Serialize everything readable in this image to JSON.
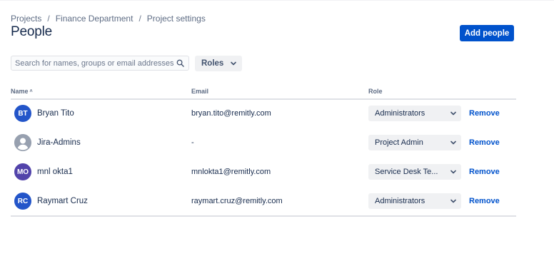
{
  "breadcrumb": [
    "Projects",
    "Finance Department",
    "Project settings"
  ],
  "breadcrumb_separator": "/",
  "page_title": "People",
  "add_button_label": "Add people",
  "search": {
    "placeholder": "Search for names, groups or email addresses",
    "value": "",
    "icon": "search-icon"
  },
  "roles_filter_label": "Roles",
  "table": {
    "headers": {
      "name": "Name",
      "name_sort": "˄",
      "email": "Email",
      "role": "Role"
    },
    "rows": [
      {
        "name": "Bryan Tito",
        "initials": "BT",
        "avatar_color": "#2355c9",
        "email": "bryan.tito@remitly.com",
        "role": "Administrators",
        "action": "Remove"
      },
      {
        "name": "Jira-Admins",
        "initials": "",
        "avatar_color": "#97a0af",
        "email": "-",
        "role": "Project Admin",
        "action": "Remove"
      },
      {
        "name": "mnl okta1",
        "initials": "MO",
        "avatar_color": "#5243aa",
        "email": "mnlokta1@remitly.com",
        "role": "Service Desk Te...",
        "action": "Remove"
      },
      {
        "name": "Raymart Cruz",
        "initials": "RC",
        "avatar_color": "#2355c9",
        "email": "raymart.cruz@remitly.com",
        "role": "Administrators",
        "action": "Remove"
      }
    ]
  },
  "colors": {
    "primary": "#0052cc",
    "text": "#172b4d",
    "subtle_text": "#5e6c84",
    "border": "#dfe1e6"
  }
}
